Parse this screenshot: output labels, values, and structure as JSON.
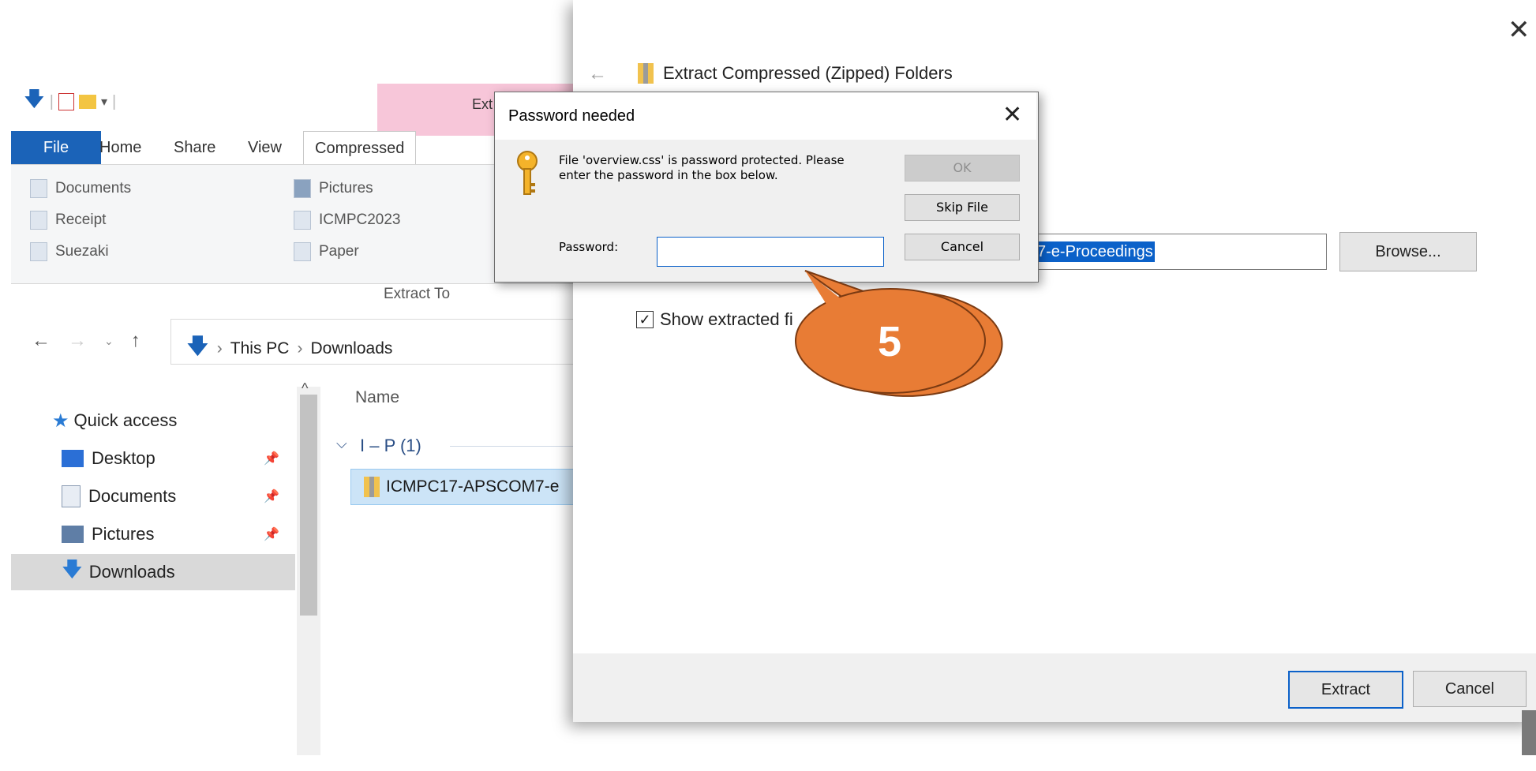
{
  "explorer": {
    "context_tab_label": "Ext",
    "tabs": [
      "File",
      "Home",
      "Share",
      "View",
      "Compressed"
    ],
    "ribbon": {
      "col1": [
        "Documents",
        "Receipt",
        "Suezaki"
      ],
      "col2": [
        "Pictures",
        "ICMPC2023",
        "Paper"
      ],
      "footer": "Extract To"
    },
    "address": {
      "root": "This PC",
      "sep": "›",
      "folder": "Downloads"
    },
    "nav": {
      "quick_access": "Quick access",
      "items": [
        "Desktop",
        "Documents",
        "Pictures",
        "Downloads"
      ]
    },
    "list": {
      "column_name": "Name",
      "group": "I – P (1)",
      "file": "ICMPC17-APSCOM7-e"
    }
  },
  "extract_dialog": {
    "title": "Extract Compressed (Zipped) Folders",
    "path_selected": "7-e-Proceedings",
    "browse": "Browse...",
    "show_extracted": "Show extracted fi",
    "extract": "Extract",
    "cancel": "Cancel"
  },
  "password_dialog": {
    "title": "Password needed",
    "message": "File 'overview.css' is password protected. Please enter the password in the box below.",
    "password_label": "Password:",
    "password_value": "",
    "ok": "OK",
    "skip": "Skip File",
    "cancel": "Cancel"
  },
  "callout": {
    "number": "5",
    "color": "#e87c35"
  },
  "colors": {
    "accent": "#1b63b8",
    "selection": "#0b61c9",
    "context_tab": "#f7c6d9"
  }
}
